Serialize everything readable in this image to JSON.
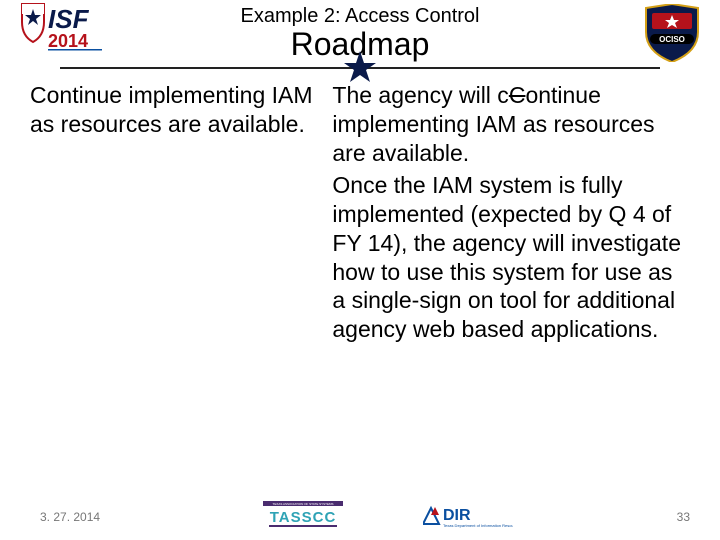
{
  "header": {
    "subtitle": "Example 2: Access Control",
    "title": "Roadmap"
  },
  "body": {
    "left": "Continue implementing IAM as resources are available.",
    "right": {
      "p1_prefix": "The agency will c",
      "p1_strike": "C",
      "p1_suffix": "ontinue implementing IAM as resources are available.",
      "p2": "Once the IAM system is fully implemented (expected by Q 4 of FY 14), the agency will investigate how to use this system for use as a single-sign on tool for additional agency web based applications."
    }
  },
  "footer": {
    "date": "3. 27. 2014",
    "page": "33"
  },
  "logos": {
    "isf": "ISF 2014",
    "ociso": "OCISO",
    "tasscc": "TASSCC",
    "dir": "DIR"
  },
  "colors": {
    "navy": "#0a1a4a",
    "red": "#b5121b",
    "blue": "#0a4fa0",
    "gold": "#d4a017",
    "tasscc_teal": "#2fa3b5",
    "tasscc_top": "#4a2c6f"
  }
}
